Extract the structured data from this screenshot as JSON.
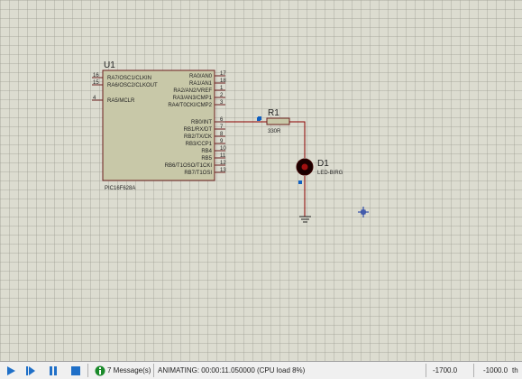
{
  "schematic": {
    "chip": {
      "ref": "U1",
      "part": "PIC16F628A",
      "left_pins": [
        {
          "num": "16",
          "name": "RA7/OSC1/CLKIN"
        },
        {
          "num": "15",
          "name": "RA6/OSC2/CLKOUT"
        },
        {
          "num": "4",
          "name": "RA5/MCLR"
        }
      ],
      "right_pins": [
        {
          "num": "17",
          "name": "RA0/AN0"
        },
        {
          "num": "18",
          "name": "RA1/AN1"
        },
        {
          "num": "1",
          "name": "RA2/AN2/VREF"
        },
        {
          "num": "2",
          "name": "RA3/AN3/CMP1"
        },
        {
          "num": "3",
          "name": "RA4/T0CKI/CMP2"
        },
        {
          "num": "6",
          "name": "RB0/INT"
        },
        {
          "num": "7",
          "name": "RB1/RX/DT"
        },
        {
          "num": "8",
          "name": "RB2/TX/CK"
        },
        {
          "num": "9",
          "name": "RB3/CCP1"
        },
        {
          "num": "10",
          "name": "RB4"
        },
        {
          "num": "11",
          "name": "RB5"
        },
        {
          "num": "12",
          "name": "RB6/T1OSO/T1CKI"
        },
        {
          "num": "13",
          "name": "RB7/T1OSI"
        }
      ]
    },
    "resistor": {
      "ref": "R1",
      "value": "330R"
    },
    "led": {
      "ref": "D1",
      "part": "LED-BIRG"
    }
  },
  "statusbar": {
    "messages": "7 Message(s)",
    "animating": "ANIMATING: 00:00:11.050000 (CPU load 8%)",
    "coord_x": "-1700.0",
    "coord_y": "-1000.0",
    "units": "th"
  },
  "colors": {
    "chip_fill": "#c8c8a8",
    "wire": "#8b0000",
    "led": "#8b0000",
    "accent": "#1060c0"
  }
}
